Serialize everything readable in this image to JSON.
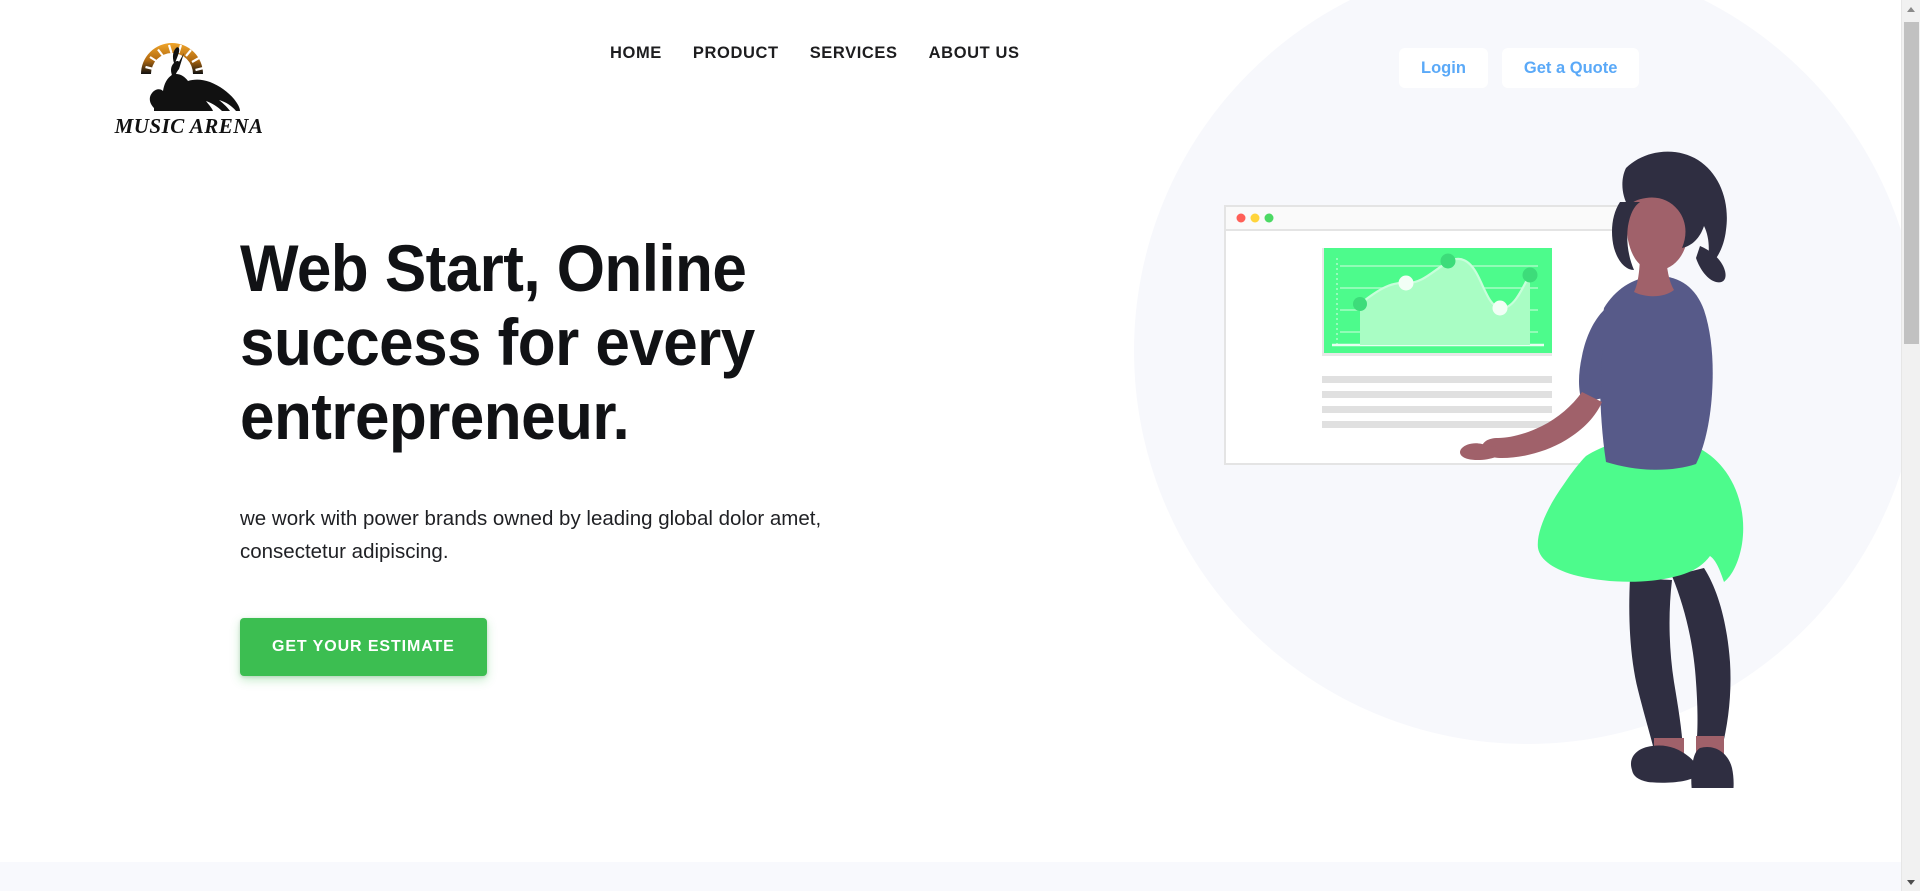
{
  "brand": {
    "logo_name": "Music Arena",
    "logo_wordmark_first": "Music",
    "logo_wordmark_second": "Arena",
    "logo_icon": "speedometer-hare-logo",
    "arc_color": "#e8971c",
    "mark_color": "#111111"
  },
  "nav": {
    "items": [
      {
        "label": "HOME",
        "name": "nav-link-home"
      },
      {
        "label": "PRODUCT",
        "name": "nav-link-product"
      },
      {
        "label": "SERVICES",
        "name": "nav-link-services"
      },
      {
        "label": "ABOUT US",
        "name": "nav-link-about-us"
      }
    ]
  },
  "header_actions": {
    "login_label": "Login",
    "quote_label": "Get a Quote",
    "link_color": "#5aa9f8"
  },
  "hero": {
    "title": "Web Start, Online success for every entrepreneur.",
    "subtitle": "we work with power brands owned by leading global dolor amet, consectetur adipiscing.",
    "cta_label": "GET YOUR ESTIMATE",
    "cta_color": "#3cbe51",
    "circle_color": "#f7f8fc"
  },
  "illustration": {
    "name": "woman-with-browser-window-illustration",
    "browser_window": {
      "dots": [
        "#ff5f57",
        "#ffd43b",
        "#4cd964"
      ],
      "chart_panel_color": "#4dfb8c",
      "chart_area_color": "#9dfdb9",
      "placeholder_bars": 4,
      "placeholder_bar_color": "#e0e0e0"
    },
    "figure": {
      "hair_color": "#2f2e41",
      "skin_color": "#a0616a",
      "top_color": "#575a89",
      "skirt_color": "#4dfb8c",
      "pants_color": "#2f2e41",
      "shoe_color": "#2f2e41"
    }
  },
  "chart_data": {
    "type": "area",
    "title": "",
    "xlabel": "",
    "ylabel": "",
    "x": [
      0,
      1,
      2,
      3,
      4,
      5,
      6,
      7
    ],
    "values": [
      0,
      42,
      58,
      74,
      56,
      30,
      34,
      62
    ],
    "markers": [
      {
        "x": 1,
        "y": 42,
        "color": "#3ddc7a"
      },
      {
        "x": 2,
        "y": 58,
        "color": "#f2fff6"
      },
      {
        "x": 3,
        "y": 74,
        "color": "#3ddc7a"
      },
      {
        "x": 5,
        "y": 30,
        "color": "#f2fff6"
      },
      {
        "x": 7,
        "y": 62,
        "color": "#3ddc7a"
      }
    ],
    "ylim": [
      0,
      100
    ],
    "grid": true,
    "gridlines": 4,
    "legend": "none"
  },
  "scrollbar": {
    "up_arrow": "scroll-up-arrow",
    "down_arrow": "scroll-down-arrow",
    "thumb": "scroll-thumb"
  },
  "next_section": {
    "background": "#f8f9fd"
  }
}
